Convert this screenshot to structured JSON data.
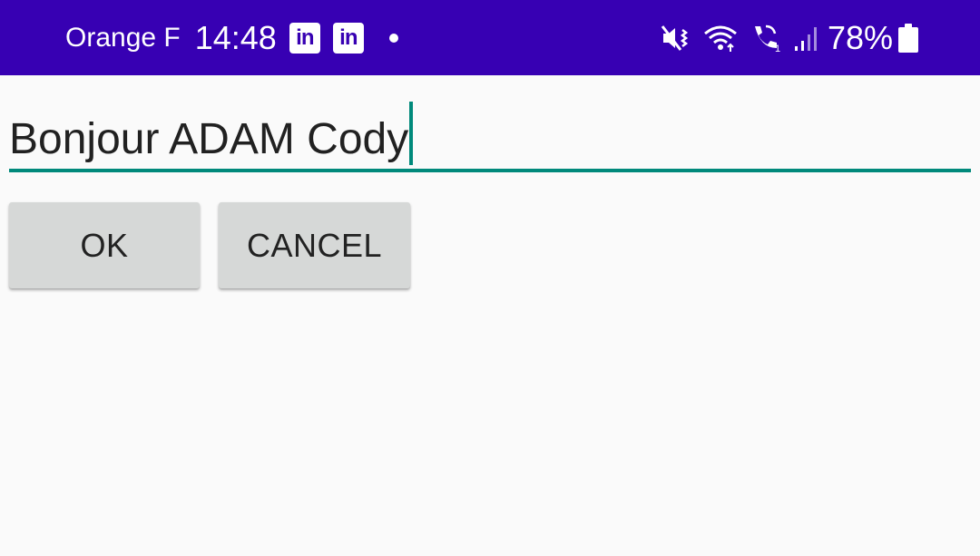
{
  "status_bar": {
    "carrier": "Orange F",
    "time": "14:48",
    "notif_icon_text": "in",
    "battery": "78%",
    "bg_color": "#3700b3"
  },
  "editor": {
    "value": "Bonjour ADAM Cody",
    "accent_color": "#00897b"
  },
  "buttons": {
    "ok_label": "OK",
    "cancel_label": "CANCEL"
  },
  "icons": [
    "linkedin-icon",
    "linkedin-icon",
    "notification-dot-icon",
    "mute-vibrate-icon",
    "wifi-icon",
    "wifi-calling-icon",
    "signal-icon",
    "battery-icon"
  ]
}
